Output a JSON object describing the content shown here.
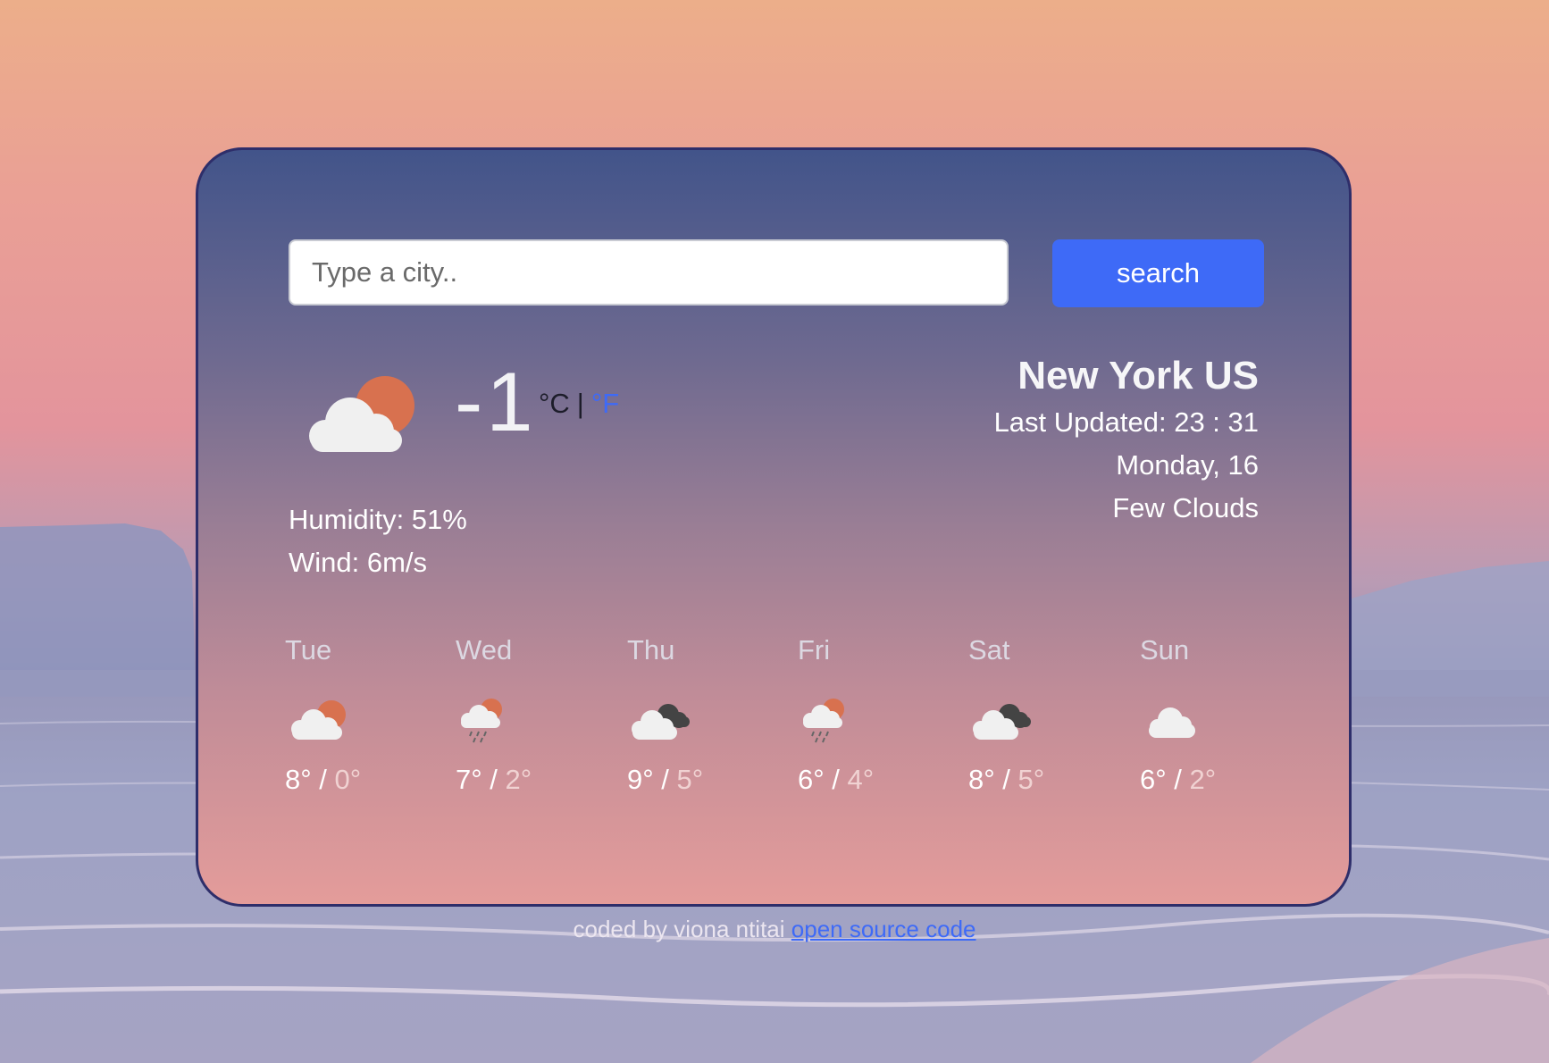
{
  "search": {
    "placeholder": "Type a city..",
    "button_label": "search"
  },
  "current": {
    "icon": "cloud-sun-icon",
    "temperature": "-1",
    "unit_celsius": "°C",
    "unit_separator": "|",
    "unit_fahrenheit": "°F",
    "humidity": "Humidity: 51%",
    "wind": "Wind: 6m/s"
  },
  "location": {
    "city": "New York US",
    "last_updated": "Last Updated: 23 : 31",
    "date": "Monday, 16",
    "description": "Few Clouds"
  },
  "forecast": [
    {
      "day": "Tue",
      "icon": "cloud-sun-icon",
      "max": "8°",
      "sep": " / ",
      "min": "0°"
    },
    {
      "day": "Wed",
      "icon": "rain-sun-icon",
      "max": "7°",
      "sep": " / ",
      "min": "2°"
    },
    {
      "day": "Thu",
      "icon": "broken-clouds-icon",
      "max": "9°",
      "sep": " / ",
      "min": "5°"
    },
    {
      "day": "Fri",
      "icon": "rain-sun-icon",
      "max": "6°",
      "sep": " / ",
      "min": "4°"
    },
    {
      "day": "Sat",
      "icon": "broken-clouds-icon",
      "max": "8°",
      "sep": " / ",
      "min": "5°"
    },
    {
      "day": "Sun",
      "icon": "cloud-icon",
      "max": "6°",
      "sep": " / ",
      "min": "2°"
    }
  ],
  "footer": {
    "text": "coded by viona ntitai",
    "link_text": "open source code"
  },
  "colors": {
    "accent": "#3e6af7",
    "card_border": "#2e2e6a",
    "sun": "#d8714f"
  }
}
